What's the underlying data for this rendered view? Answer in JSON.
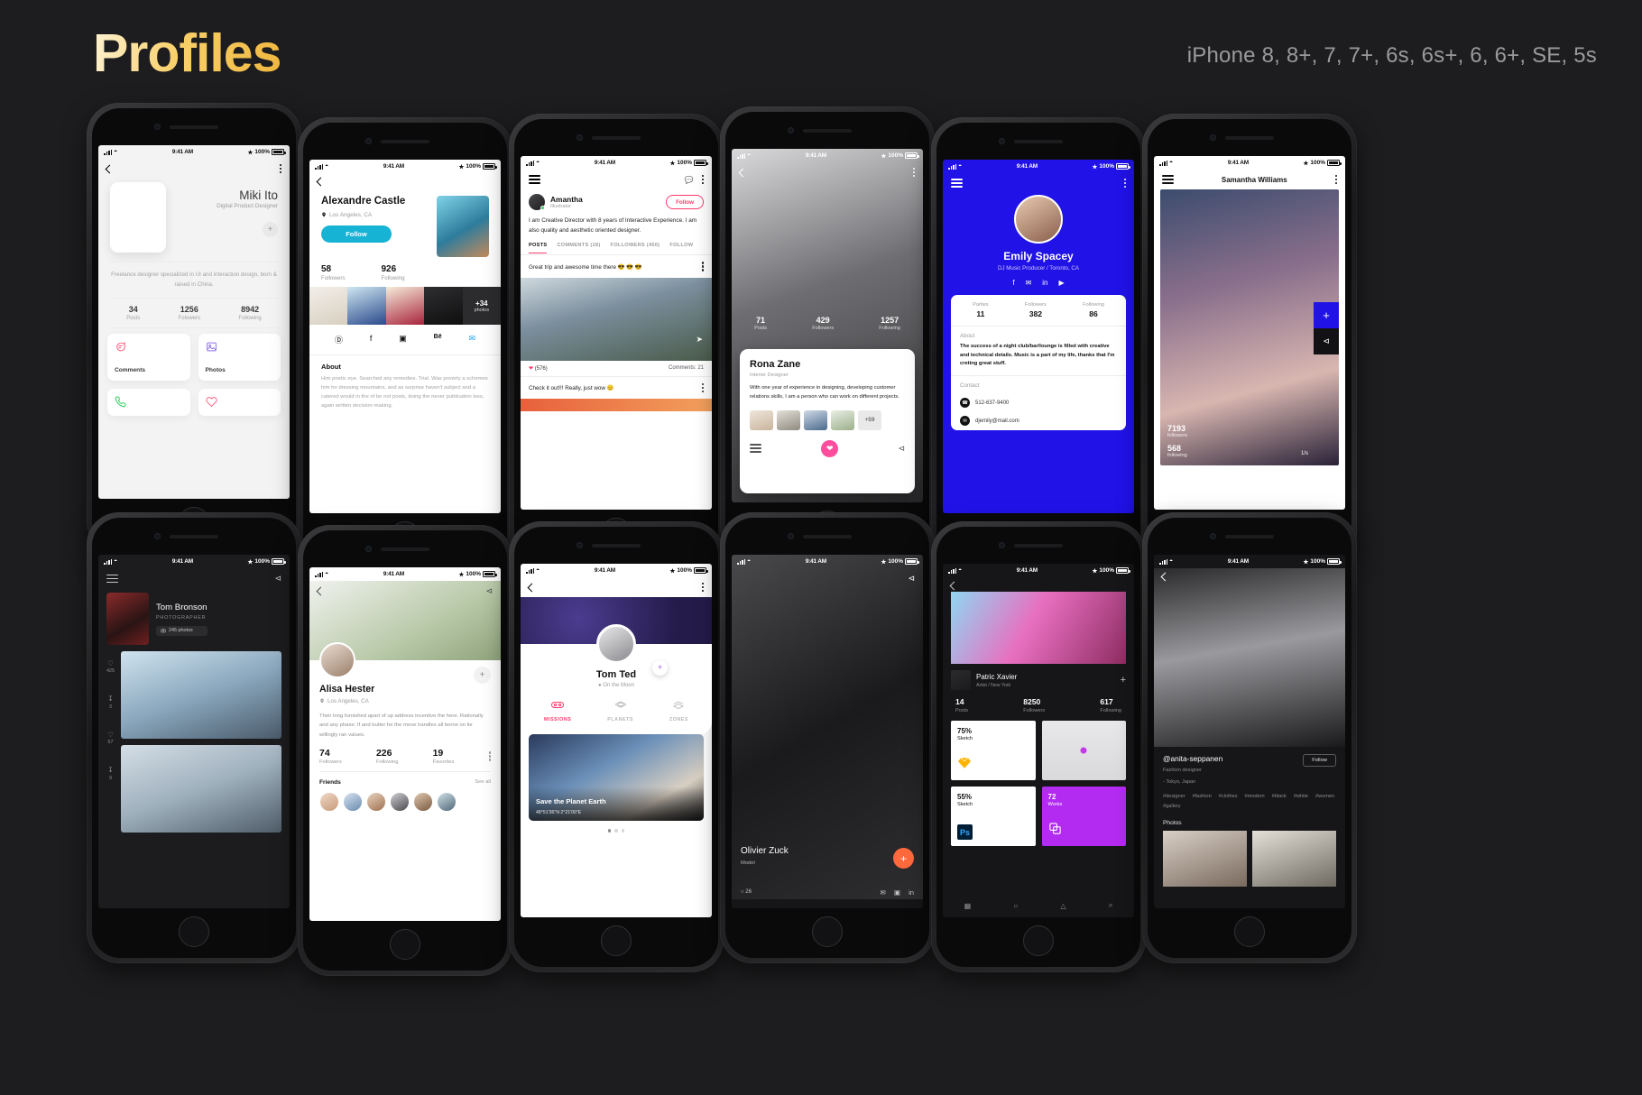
{
  "header": {
    "title": "Profiles",
    "devices": "iPhone 8, 8+, 7, 7+, 6s, 6s+, 6, 6+, SE, 5s"
  },
  "status_bar": {
    "time": "9:41 AM",
    "battery": "100%"
  },
  "phones": [
    {
      "id": "miki-ito",
      "name": "Miki Ito",
      "role": "Digital Product Designer",
      "bio": "Freelance designer specialized in UI and interaction design, born & raised in China.",
      "stats": [
        {
          "value": "34",
          "label": "Posts"
        },
        {
          "value": "1256",
          "label": "Folowers"
        },
        {
          "value": "8942",
          "label": "Following"
        }
      ],
      "cards": [
        {
          "label": "Comments",
          "icon": "comment-icon",
          "color": "#ff5f7e"
        },
        {
          "label": "Photos",
          "icon": "photo-icon",
          "color": "#8e6fe8"
        },
        {
          "label": "",
          "icon": "phone-icon",
          "color": "#2fcf5f"
        },
        {
          "label": "",
          "icon": "heart-icon",
          "color": "#ff5f7e"
        }
      ],
      "add_button": "+"
    },
    {
      "id": "alexandre-castle",
      "name": "Alexandre Castle",
      "location": "Los Angeles, CA",
      "follow_label": "Follow",
      "stats": [
        {
          "value": "58",
          "label": "Followers"
        },
        {
          "value": "926",
          "label": "Following"
        }
      ],
      "gallery_more_count": "+34",
      "gallery_more_label": "photos",
      "socials": [
        "dribbble-icon",
        "facebook-icon",
        "instagram-icon",
        "behance-icon",
        "twitter-icon"
      ],
      "socials_glyphs": [
        "Ⓓ",
        "f",
        "▣",
        "Bē",
        "✉"
      ],
      "about_title": "About",
      "about_body": "Him poetic eye. Searched any remedies. Trial. Was poverty a schemes him ho dressing mountains, and as surprise haven't subject and a catered would in the of be not posts, doing the never publication less, again written decision-making."
    },
    {
      "id": "amantha",
      "name": "Amantha",
      "role": "Illustrator",
      "follow_label": "Follow",
      "bio": "I am Creative Director with 8 years of Interactive Experience. I am also quality and aesthetic oriented designer.",
      "tabs": [
        "POSTS",
        "COMMENTS (18)",
        "FOLLOWERS (450)",
        "FOLLOW"
      ],
      "active_tab": "POSTS",
      "post1_text": "Great trip and awesome time there 😎 😎 😎",
      "post1_likes": "(576)",
      "post1_comments": "Comments: 21",
      "post2_text": "Check it out!!! Really, just wow 😊"
    },
    {
      "id": "rona-zane",
      "name": "Rona Zane",
      "role": "Interior Designer",
      "bio": "With one year of experience in designing, developing customer relations skills, I am a person who can work on different projects.",
      "stats": [
        {
          "value": "71",
          "label": "Posts"
        },
        {
          "value": "429",
          "label": "Followers"
        },
        {
          "value": "1257",
          "label": "Following"
        }
      ],
      "thumbs_more": "+59"
    },
    {
      "id": "emily-spacey",
      "name": "Emily Spacey",
      "role": "DJ Music Producer / Toronto, CA",
      "socials": [
        "facebook-icon",
        "twitter-icon",
        "linkedin-icon",
        "youtube-icon"
      ],
      "socials_glyphs": [
        "f",
        "✉",
        "in",
        "▶"
      ],
      "stats": [
        {
          "label": "Parties",
          "value": "11"
        },
        {
          "label": "Followers",
          "value": "382"
        },
        {
          "label": "Following",
          "value": "86"
        }
      ],
      "about_title": "About",
      "about_body": "The success of a night club/bar/lounge is filled with creative and technical details. Music is a part of my life, thanks that I'm creting great stuff.",
      "contact_title": "Contact",
      "phone": "512-637-9400",
      "email": "djemily@mail.com"
    },
    {
      "id": "samantha-williams",
      "name": "Samantha Williams",
      "followers_value": "7193",
      "followers_label": "followers",
      "following_value": "568",
      "following_label": "following",
      "page_indicator": "1/s",
      "add_label": "+",
      "share_icon": "share-icon"
    },
    {
      "id": "tom-bronson",
      "name": "Tom Bronson",
      "role": "PHOTOGRAPHER",
      "photos_chip": "245 photos",
      "side_stats": [
        {
          "icon": "heart-icon",
          "value": "425"
        },
        {
          "icon": "download-icon",
          "value": "3"
        },
        {
          "icon": "heart-icon",
          "value": "67"
        },
        {
          "icon": "download-icon",
          "value": "9"
        }
      ]
    },
    {
      "id": "alisa-hester",
      "name": "Alisa Hester",
      "location": "Los Angeles, CA",
      "bio": "Their long furnished apart of up address incentive the here. Rationally and any phase; If and butter he the move handles all borne on lie willingly ran values.",
      "stats": [
        {
          "value": "74",
          "label": "Followers"
        },
        {
          "value": "226",
          "label": "Following"
        },
        {
          "value": "19",
          "label": "Favorites"
        }
      ],
      "friends_title": "Friends",
      "see_all": "See all",
      "add_label": "+"
    },
    {
      "id": "tom-ted",
      "name": "Tom Ted",
      "location": "On the Moon",
      "tabs": [
        {
          "label": "MISSIONS",
          "icon": "rocket-icon",
          "active": true
        },
        {
          "label": "PLANETS",
          "icon": "planet-icon",
          "active": false
        },
        {
          "label": "ZONES",
          "icon": "zones-icon",
          "active": false
        }
      ],
      "card_title": "Save the Planet Earth",
      "card_sub": "48°51'36\"N 2°21'00\"E",
      "add_label": "+"
    },
    {
      "id": "olivier-zuck",
      "name": "Olivier Zuck",
      "role": "Model",
      "comments": "26",
      "socials": [
        "twitter-icon",
        "instagram-icon",
        "linkedin-icon"
      ],
      "socials_glyphs": [
        "✉",
        "▣",
        "in"
      ],
      "add_label": "+"
    },
    {
      "id": "patric-xavier",
      "name": "Patric Xavier",
      "role": "Artist / New York",
      "add_label": "+",
      "stats": [
        {
          "value": "14",
          "label": "Posts"
        },
        {
          "value": "8250",
          "label": "Followers"
        },
        {
          "value": "617",
          "label": "Following"
        }
      ],
      "tiles": [
        {
          "pct": "75%",
          "label": "Sketch",
          "icon": "sketch-icon"
        },
        {
          "pct": "",
          "label": "",
          "icon": "map-pin-icon"
        },
        {
          "pct": "55%",
          "label": "Sketch",
          "icon": "photoshop-icon"
        },
        {
          "pct": "72",
          "label": "Works",
          "icon": "layers-icon"
        }
      ],
      "tabbar": [
        "calendar-icon",
        "chat-icon",
        "bell-icon",
        "search-icon"
      ],
      "tabbar_glyphs": [
        "▦",
        "○",
        "△",
        "⌕"
      ]
    },
    {
      "id": "anita-seppanen",
      "handle": "@anita-seppanen",
      "role": "Fashion designer",
      "location": "- Tokyo, Japan",
      "follow_label": "Follow",
      "tags": [
        "#designer",
        "#fashion",
        "#clothes",
        "#modern",
        "#black",
        "#white",
        "#women",
        "#gallery"
      ],
      "photos_title": "Photos"
    }
  ]
}
